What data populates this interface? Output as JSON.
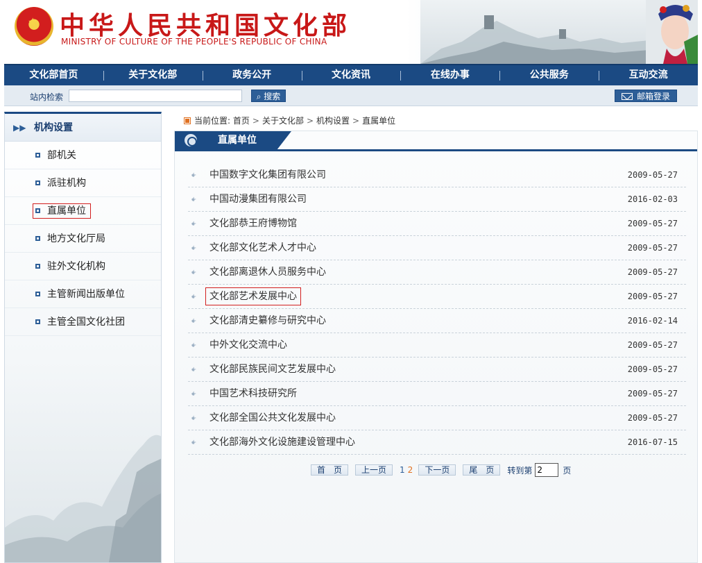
{
  "header": {
    "title": "中华人民共和国文化部",
    "subtitle": "MINISTRY OF CULTURE OF THE PEOPLE'S REPUBLIC OF CHINA"
  },
  "nav": [
    {
      "label": "文化部首页"
    },
    {
      "label": "关于文化部"
    },
    {
      "label": "政务公开"
    },
    {
      "label": "文化资讯"
    },
    {
      "label": "在线办事"
    },
    {
      "label": "公共服务"
    },
    {
      "label": "互动交流"
    }
  ],
  "search": {
    "label": "站内检索",
    "value": "",
    "placeholder": "",
    "button": "搜索",
    "mail_button": "邮箱登录"
  },
  "sidebar": {
    "title": "机构设置",
    "items": [
      {
        "label": "部机关"
      },
      {
        "label": "派驻机构"
      },
      {
        "label": "直属单位"
      },
      {
        "label": "地方文化厅局"
      },
      {
        "label": "驻外文化机构"
      },
      {
        "label": "主管新闻出版单位"
      },
      {
        "label": "主管全国文化社团"
      }
    ],
    "active": "直属单位"
  },
  "breadcrumb": {
    "prefix": "当前位置:",
    "items": [
      "首页",
      "关于文化部",
      "机构设置",
      "直属单位"
    ]
  },
  "section_title": "直属单位",
  "list": [
    {
      "name": "中国数字文化集团有限公司",
      "date": "2009-05-27"
    },
    {
      "name": "中国动漫集团有限公司",
      "date": "2016-02-03"
    },
    {
      "name": "文化部恭王府博物馆",
      "date": "2009-05-27"
    },
    {
      "name": "文化部文化艺术人才中心",
      "date": "2009-05-27"
    },
    {
      "name": "文化部离退休人员服务中心",
      "date": "2009-05-27"
    },
    {
      "name": "文化部艺术发展中心",
      "date": "2009-05-27"
    },
    {
      "name": "文化部清史纂修与研究中心",
      "date": "2016-02-14"
    },
    {
      "name": "中外文化交流中心",
      "date": "2009-05-27"
    },
    {
      "name": "文化部民族民间文艺发展中心",
      "date": "2009-05-27"
    },
    {
      "name": "中国艺术科技研究所",
      "date": "2009-05-27"
    },
    {
      "name": "文化部全国公共文化发展中心",
      "date": "2009-05-27"
    },
    {
      "name": "文化部海外文化设施建设管理中心",
      "date": "2016-07-15"
    }
  ],
  "pagination": {
    "first": "首　页",
    "prev": "上一页",
    "page1": "1",
    "page2": "2",
    "next": "下一页",
    "last": "尾　页",
    "goto": "转到第",
    "goto_value": "2",
    "unit": "页"
  },
  "colors": {
    "brand_red": "#c81818",
    "nav_blue": "#1b4a83",
    "highlight_box": "#d21e1e"
  }
}
